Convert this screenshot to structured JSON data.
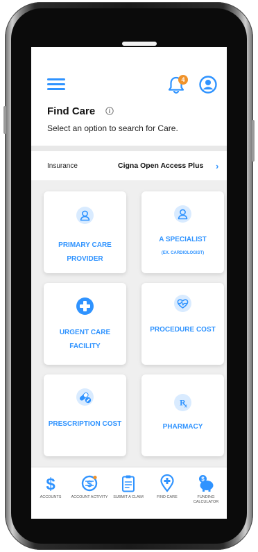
{
  "colors": {
    "accent": "#2f93ff",
    "badge": "#f0932b"
  },
  "header": {
    "title": "Find Care",
    "subtitle": "Select an option to search for Care.",
    "notification_count": "4"
  },
  "insurance": {
    "label": "Insurance",
    "plan": "Cigna Open Access Plus",
    "chevron": "›"
  },
  "tiles": [
    {
      "label": "PRIMARY CARE PROVIDER",
      "icon": "doctor-icon"
    },
    {
      "label": "A SPECIALIST",
      "sub": "(EX. CARDIOLOGIST)",
      "icon": "specialist-icon"
    },
    {
      "label": "URGENT CARE FACILITY",
      "icon": "medical-cross-icon"
    },
    {
      "label": "PROCEDURE COST",
      "icon": "heart-monitor-icon"
    },
    {
      "label": "PRESCRIPTION COST",
      "icon": "pills-icon"
    },
    {
      "label": "PHARMACY",
      "icon": "rx-icon"
    }
  ],
  "bottom_nav": [
    {
      "label": "ACCOUNTS",
      "icon": "dollar-icon"
    },
    {
      "label": "ACCOUNT ACTIVITY",
      "icon": "account-activity-icon"
    },
    {
      "label": "SUBMIT A CLAIM",
      "icon": "clipboard-icon"
    },
    {
      "label": "FIND CARE",
      "icon": "location-pin-icon"
    },
    {
      "label": "FUNDING CALCULATOR",
      "icon": "piggy-bank-icon"
    }
  ]
}
